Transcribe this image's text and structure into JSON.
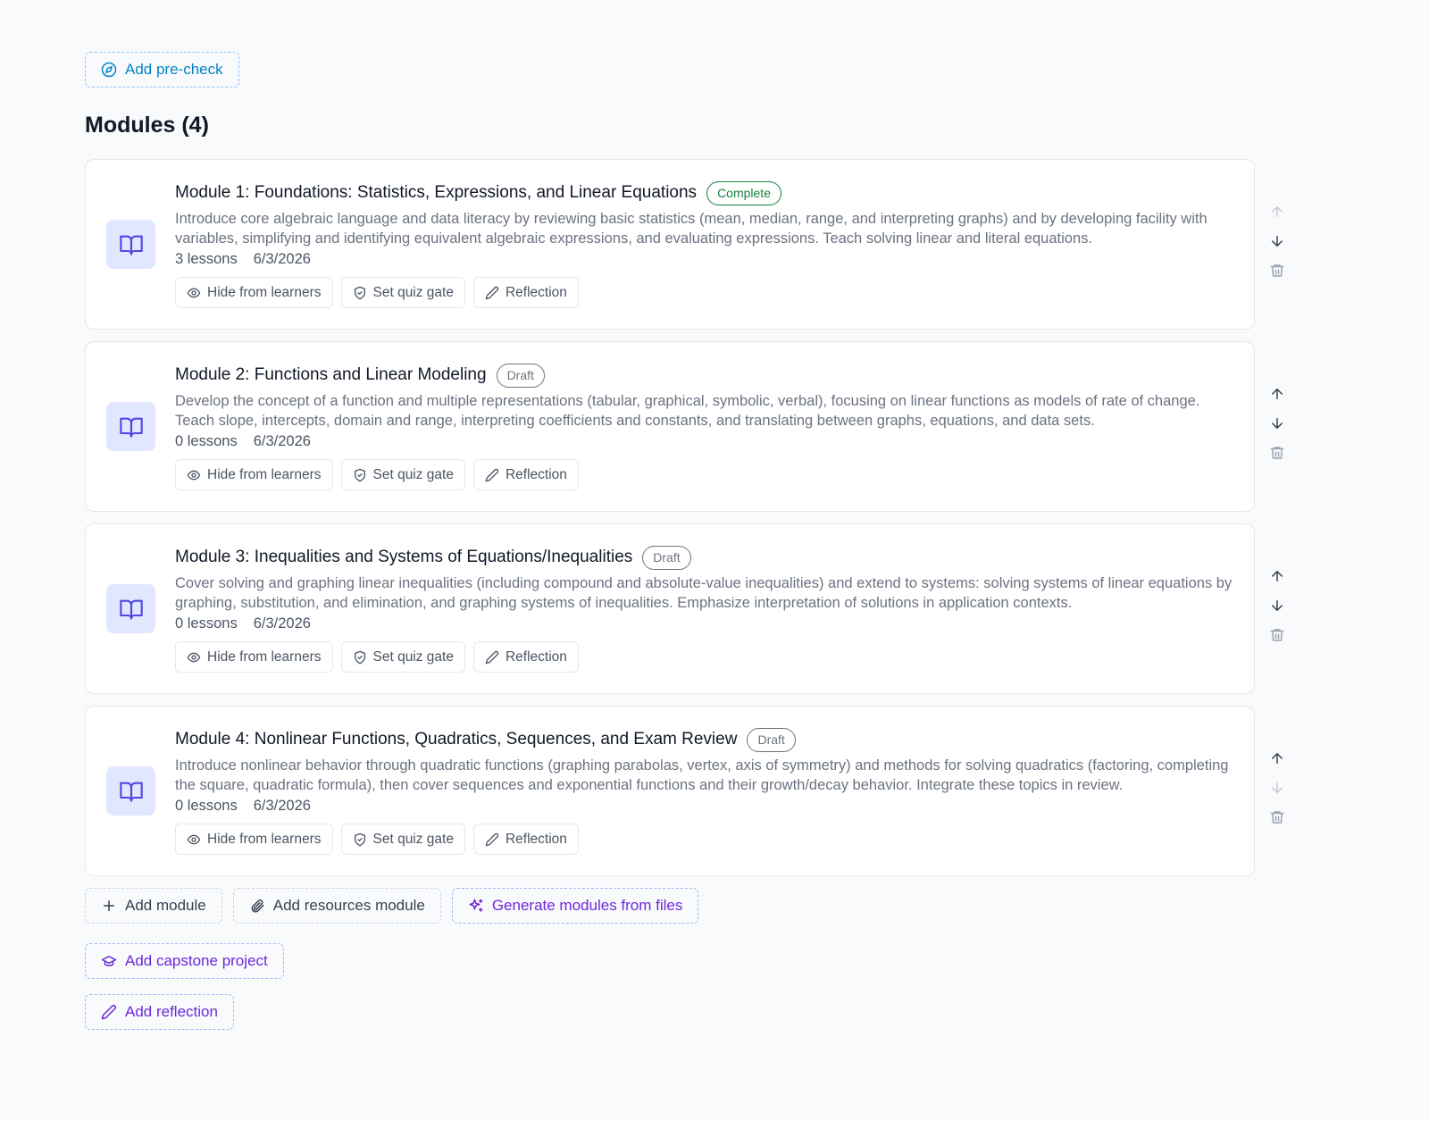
{
  "precheck": {
    "label": "Add pre-check"
  },
  "modules_heading": "Modules (4)",
  "modules": [
    {
      "title": "Module 1: Foundations: Statistics, Expressions, and Linear Equations",
      "status": "Complete",
      "description": "Introduce core algebraic language and data literacy by reviewing basic statistics (mean, median, range, and interpreting graphs) and by developing facility with variables, simplifying and identifying equivalent algebraic expressions, and evaluating expressions. Teach solving linear and literal equations.",
      "lessons": "3 lessons",
      "date": "6/3/2026"
    },
    {
      "title": "Module 2: Functions and Linear Modeling",
      "status": "Draft",
      "description": "Develop the concept of a function and multiple representations (tabular, graphical, symbolic, verbal), focusing on linear functions as models of rate of change. Teach slope, intercepts, domain and range, interpreting coefficients and constants, and translating between graphs, equations, and data sets.",
      "lessons": "0 lessons",
      "date": "6/3/2026"
    },
    {
      "title": "Module 3: Inequalities and Systems of Equations/Inequalities",
      "status": "Draft",
      "description": "Cover solving and graphing linear inequalities (including compound and absolute-value inequalities) and extend to systems: solving systems of linear equations by graphing, substitution, and elimination, and graphing systems of inequalities. Emphasize interpretation of solutions in application contexts.",
      "lessons": "0 lessons",
      "date": "6/3/2026"
    },
    {
      "title": "Module 4: Nonlinear Functions, Quadratics, Sequences, and Exam Review",
      "status": "Draft",
      "description": "Introduce nonlinear behavior through quadratic functions (graphing parabolas, vertex, axis of symmetry) and methods for solving quadratics (factoring, completing the square, quadratic formula), then cover sequences and exponential functions and their growth/decay behavior. Integrate these topics in review.",
      "lessons": "0 lessons",
      "date": "6/3/2026"
    }
  ],
  "module_actions": {
    "hide": "Hide from learners",
    "quiz": "Set quiz gate",
    "reflection": "Reflection"
  },
  "bottom": {
    "add_module": "Add module",
    "add_resources": "Add resources module",
    "generate": "Generate modules from files",
    "capstone": "Add capstone project",
    "reflection": "Add reflection"
  },
  "colors": {
    "accent_sky": "#0284c7",
    "accent_violet": "#6d28d9",
    "complete_green": "#15803d",
    "icon_bg": "#e0e7ff"
  }
}
